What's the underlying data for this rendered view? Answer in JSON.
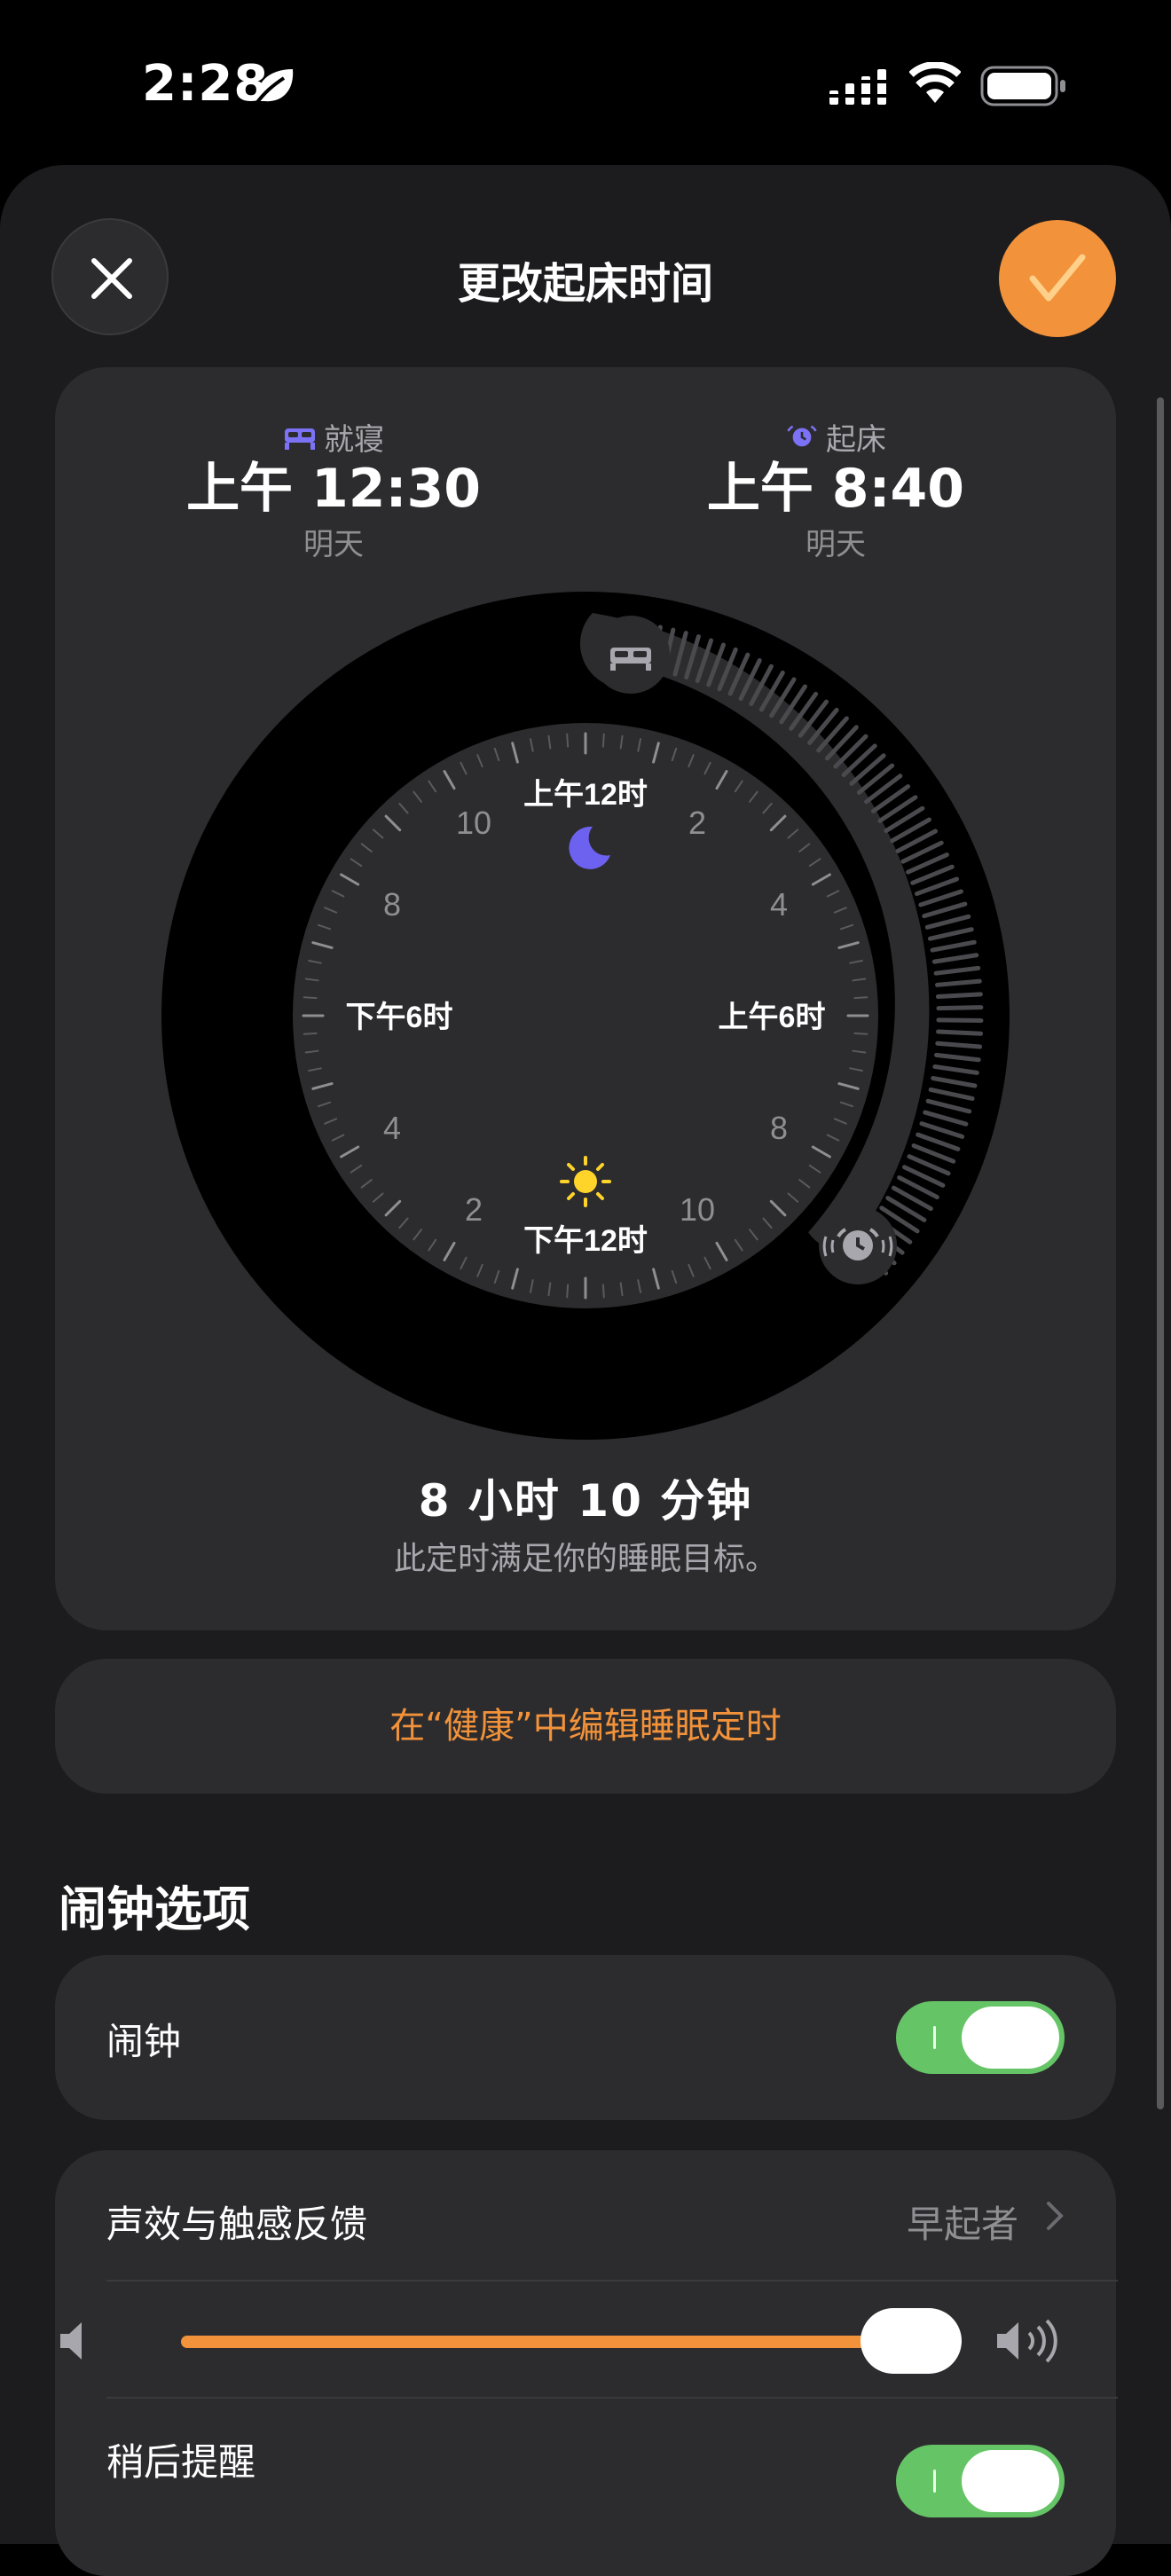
{
  "status_bar": {
    "time": "2:28"
  },
  "header": {
    "title": "更改起床时间"
  },
  "schedule": {
    "bedtime": {
      "label": "就寝",
      "time": "上午 12:30",
      "day": "明天"
    },
    "wake": {
      "label": "起床",
      "time": "上午 8:40",
      "day": "明天"
    },
    "clock_labels": {
      "top": "上午12时",
      "right": "上午6时",
      "bottom": "下午12时",
      "left": "下午6时",
      "n2a": "2",
      "n4a": "4",
      "n8a": "8",
      "n10a": "10",
      "n2b": "2",
      "n4b": "4",
      "n8b": "8",
      "n10b": "10"
    },
    "duration": "8 小时 10 分钟",
    "goal_text": "此定时满足你的睡眠目标。"
  },
  "edit_link": "在“健康”中编辑睡眠定时",
  "alarm_options": {
    "heading": "闹钟选项",
    "alarm": {
      "label": "闹钟",
      "on": true
    },
    "sound": {
      "label": "声效与触感反馈",
      "value": "早起者"
    },
    "volume": {
      "level": 1.0
    },
    "snooze": {
      "label": "稍后提醒",
      "on": true
    }
  },
  "colors": {
    "accent": "#f2923a",
    "toggle_on": "#65c466",
    "bed_icon": "#7b72f5",
    "moon": "#6d62f0",
    "sun": "#ffd42a",
    "sheet_bg": "#1c1c1e",
    "card_bg": "#2c2c2e"
  }
}
